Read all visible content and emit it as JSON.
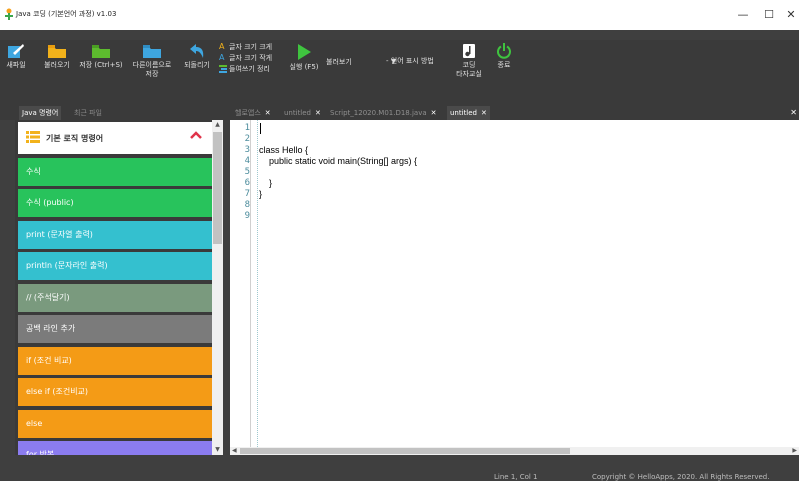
{
  "window": {
    "title": "Java 코딩 (기본언어 과정) v1.03",
    "minimize": "—",
    "maximize": "☐",
    "close": "✕"
  },
  "toolbar": {
    "new_file": "새파일",
    "open": "불러오기",
    "save": "저장 (Ctrl+S)",
    "save_as_line1": "다른이름으로",
    "save_as_line2": "저장",
    "undo": "되돌리기",
    "font_bigger": "글자 크기 크게",
    "font_smaller": "글자 크기 작게",
    "indent_cleanup": "들여쓰기 정리",
    "run": "실행 (F5)",
    "combo_value": "불러보기",
    "language_help": "- 언어 표시 방법",
    "coding_line1": "코딩",
    "coding_line2": "타자교실",
    "exit": "종료",
    "colors": {
      "new": "#3ea6e0",
      "open": "#f2b21b",
      "save": "#5dbb2e",
      "save_as": "#3ea6e0",
      "undo": "#3ea6e0",
      "run": "#3fc43f",
      "exit": "#3fc43f"
    }
  },
  "left_tabs": [
    {
      "label": "Java 명령어",
      "active": true
    },
    {
      "label": "최근 파일",
      "active": false
    }
  ],
  "editor_tabs": [
    {
      "label": "헬로앱스",
      "active": false
    },
    {
      "label": "untitled",
      "active": false
    },
    {
      "label": "Script_12020.M01.D18.java",
      "active": false
    },
    {
      "label": "untitled",
      "active": true
    }
  ],
  "tab_close_glyph": "✕",
  "command_panel": {
    "header": "기본 로직 명령어",
    "items": [
      {
        "label": "수식",
        "color": "#28c35c"
      },
      {
        "label": "수식 (public)",
        "color": "#28c35c"
      },
      {
        "label": "print (문자열 출력)",
        "color": "#34c0cf"
      },
      {
        "label": "println (문자라인 출력)",
        "color": "#34c0cf"
      },
      {
        "label": "// (주석달기)",
        "color": "#7a9a7e"
      },
      {
        "label": "공백 라인 추가",
        "color": "#7b7b7b"
      },
      {
        "label": "if (조건 비교)",
        "color": "#f49b16"
      },
      {
        "label": "else if (조건비교)",
        "color": "#f49b16"
      },
      {
        "label": "else",
        "color": "#f49b16"
      },
      {
        "label": "for 반복",
        "color": "#8b7cf0"
      }
    ]
  },
  "code": {
    "line_numbers": [
      "1",
      "2",
      "3",
      "4",
      "5",
      "6",
      "7",
      "8",
      "9"
    ],
    "lines": [
      "",
      "",
      "class Hello {",
      "    public static void main(String[] args) {",
      "",
      "    }",
      "}",
      "",
      ""
    ]
  },
  "status": {
    "cursor": "Line 1, Col 1",
    "copyright": "Copyright © HelloApps, 2020. All Rights Reserved."
  }
}
